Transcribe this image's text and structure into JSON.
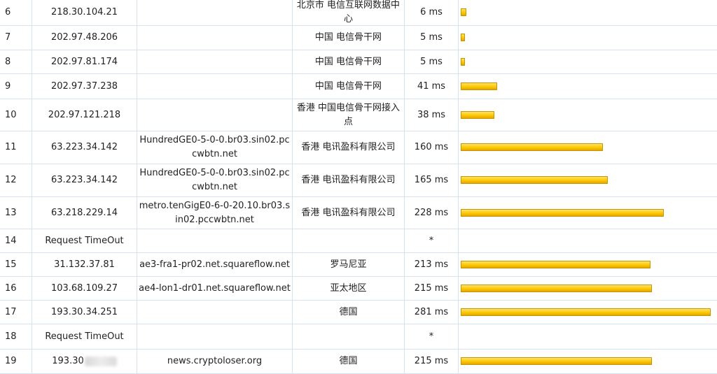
{
  "rows": [
    {
      "hop": "6",
      "ip": "218.30.104.21",
      "host": "",
      "location": "北京市 电信互联网数据中心",
      "latency": "6 ms",
      "ms": 6
    },
    {
      "hop": "7",
      "ip": "202.97.48.206",
      "host": "",
      "location": "中国 电信骨干网",
      "latency": "5 ms",
      "ms": 5
    },
    {
      "hop": "8",
      "ip": "202.97.81.174",
      "host": "",
      "location": "中国 电信骨干网",
      "latency": "5 ms",
      "ms": 5
    },
    {
      "hop": "9",
      "ip": "202.97.37.238",
      "host": "",
      "location": "中国 电信骨干网",
      "latency": "41 ms",
      "ms": 41
    },
    {
      "hop": "10",
      "ip": "202.97.121.218",
      "host": "",
      "location": "香港 中国电信骨干网接入点",
      "latency": "38 ms",
      "ms": 38
    },
    {
      "hop": "11",
      "ip": "63.223.34.142",
      "host": "HundredGE0-5-0-0.br03.sin02.pccwbtn.net",
      "location": "香港 电讯盈科有限公司",
      "latency": "160 ms",
      "ms": 160
    },
    {
      "hop": "12",
      "ip": "63.223.34.142",
      "host": "HundredGE0-5-0-0.br03.sin02.pccwbtn.net",
      "location": "香港 电讯盈科有限公司",
      "latency": "165 ms",
      "ms": 165
    },
    {
      "hop": "13",
      "ip": "63.218.229.14",
      "host": "metro.tenGigE0-6-0-20.10.br03.sin02.pccwbtn.net",
      "location": "香港 电讯盈科有限公司",
      "latency": "228 ms",
      "ms": 228
    },
    {
      "hop": "14",
      "ip": "Request TimeOut",
      "host": "",
      "location": "",
      "latency": "*",
      "ms": null
    },
    {
      "hop": "15",
      "ip": "31.132.37.81",
      "host": "ae3-fra1-pr02.net.squareflow.net",
      "location": "罗马尼亚",
      "latency": "213 ms",
      "ms": 213
    },
    {
      "hop": "16",
      "ip": "103.68.109.27",
      "host": "ae4-lon1-dr01.net.squareflow.net",
      "location": "亚太地区",
      "latency": "215 ms",
      "ms": 215
    },
    {
      "hop": "17",
      "ip": "193.30.34.251",
      "host": "",
      "location": "德国",
      "latency": "281 ms",
      "ms": 281
    },
    {
      "hop": "18",
      "ip": "Request TimeOut",
      "host": "",
      "location": "",
      "latency": "*",
      "ms": null
    },
    {
      "hop": "19",
      "ip": "193.30",
      "host": "news.cryptoloser.org",
      "location": "德国",
      "latency": "215 ms",
      "ms": 215
    }
  ],
  "colors": {
    "bar": "#ffc800",
    "grid": "#d6e2ee"
  }
}
